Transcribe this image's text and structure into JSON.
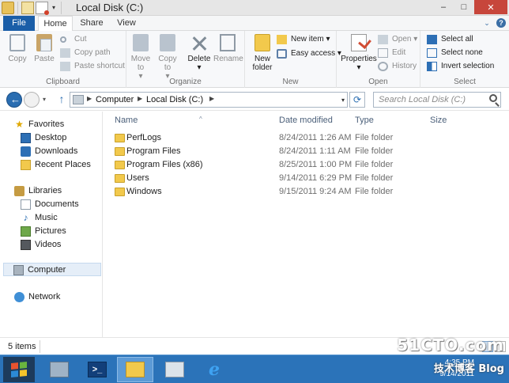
{
  "window": {
    "title": "Local Disk (C:)",
    "controls": {
      "minimize": "–",
      "maximize": "□",
      "close": "✕"
    }
  },
  "qat": {
    "caret": "▾"
  },
  "tabs": [
    {
      "label": "File"
    },
    {
      "label": "Home"
    },
    {
      "label": "Share"
    },
    {
      "label": "View"
    }
  ],
  "ribbon_toggles": {
    "expand": "⌄",
    "help": "?"
  },
  "ribbon": {
    "clipboard": {
      "label": "Clipboard",
      "copy": "Copy",
      "paste": "Paste",
      "cut": "Cut",
      "copy_path": "Copy path",
      "paste_shortcut": "Paste shortcut"
    },
    "organize": {
      "label": "Organize",
      "move_to": "Move to",
      "copy_to": "Copy to",
      "delete": "Delete",
      "rename": "Rename",
      "caret": "▾"
    },
    "new": {
      "label": "New",
      "new_folder_line1": "New",
      "new_folder_line2": "folder",
      "new_item": "New item",
      "easy_access": "Easy access",
      "caret": "▾"
    },
    "open": {
      "label": "Open",
      "properties": "Properties",
      "open": "Open",
      "edit": "Edit",
      "history": "History",
      "caret": "▾"
    },
    "select": {
      "label": "Select",
      "select_all": "Select all",
      "select_none": "Select none",
      "invert_selection": "Invert selection"
    }
  },
  "address": {
    "crumbs": [
      "Computer",
      "Local Disk (C:)"
    ],
    "sep": "▶",
    "dropdown": "▾",
    "refresh": "⟳",
    "up": "↑",
    "recent": "▾"
  },
  "search": {
    "placeholder": "Search Local Disk (C:)"
  },
  "nav": {
    "favorites": "Favorites",
    "desktop": "Desktop",
    "downloads": "Downloads",
    "recent_places": "Recent Places",
    "libraries": "Libraries",
    "documents": "Documents",
    "music": "Music",
    "pictures": "Pictures",
    "videos": "Videos",
    "computer": "Computer",
    "network": "Network",
    "star": "★",
    "note": "♪"
  },
  "columns": {
    "name": "Name",
    "date": "Date modified",
    "type": "Type",
    "size": "Size",
    "sort_caret": "^"
  },
  "files": [
    {
      "name": "PerfLogs",
      "date": "8/24/2011 1:26 AM",
      "type": "File folder"
    },
    {
      "name": "Program Files",
      "date": "8/24/2011 1:11 AM",
      "type": "File folder"
    },
    {
      "name": "Program Files (x86)",
      "date": "8/25/2011 1:00 PM",
      "type": "File folder"
    },
    {
      "name": "Users",
      "date": "9/14/2011 6:29 PM",
      "type": "File folder"
    },
    {
      "name": "Windows",
      "date": "9/15/2011 9:24 AM",
      "type": "File folder"
    }
  ],
  "status": {
    "items": "5 items"
  },
  "taskbar": {
    "ps_glyph": ">_",
    "ie_glyph": "e",
    "clock_time": "4:35 PM",
    "clock_date": "9/14/2011"
  },
  "watermark": {
    "logo": "51CTO.com",
    "sub": "技术博客 Blog"
  },
  "colors": {
    "file_tab": "#1a5ea8",
    "taskbar": "#2b73b9",
    "close_button": "#c7463b",
    "folder": "#f2c94c"
  }
}
